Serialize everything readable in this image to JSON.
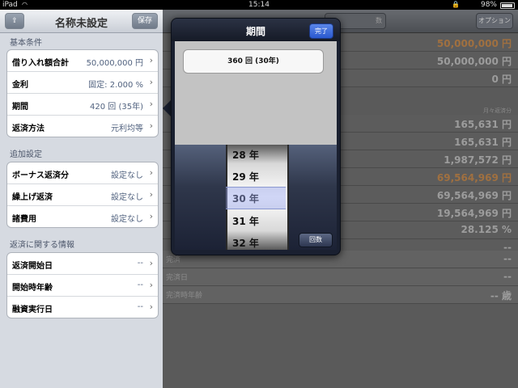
{
  "status_bar": {
    "carrier": "iPad",
    "time": "15:14",
    "battery": "98%"
  },
  "left_panel": {
    "title": "名称未設定",
    "save_label": "保存",
    "sections": [
      {
        "header": "基本条件",
        "rows": [
          {
            "label": "借り入れ額合計",
            "value": "50,000,000 円"
          },
          {
            "label": "金利",
            "value": "固定: 2.000 %"
          },
          {
            "label": "期間",
            "value": "420 回 (35年)"
          },
          {
            "label": "返済方法",
            "value": "元利均等"
          }
        ]
      },
      {
        "header": "追加設定",
        "rows": [
          {
            "label": "ボーナス返済分",
            "value": "設定なし"
          },
          {
            "label": "繰上げ返済",
            "value": "設定なし"
          },
          {
            "label": "諸費用",
            "value": "設定なし"
          }
        ]
      },
      {
        "header": "返済に関する情報",
        "rows": [
          {
            "label": "返済開始日",
            "value": "--"
          },
          {
            "label": "開始時年齢",
            "value": "--"
          },
          {
            "label": "融資実行日",
            "value": "--"
          }
        ]
      }
    ]
  },
  "right_panel": {
    "option_label": "オプション",
    "segment_label": "数",
    "caption": "月々返済分",
    "values": [
      "50,000,000 円",
      "50,000,000 円",
      "0 円",
      "165,631 円",
      "165,631 円",
      "1,987,572 円",
      "69,564,969 円",
      "69,564,969 円",
      "19,564,969 円",
      "28.125 %",
      "--"
    ],
    "bottom_labels": [
      "完済",
      "完済日",
      "完済時年齢"
    ],
    "bottom_values": [
      "--",
      "--",
      "-- 歳"
    ]
  },
  "popover": {
    "title": "期間",
    "done_label": "完了",
    "field_value": "360 回 (30年)",
    "picker_items": [
      "28 年",
      "29 年",
      "30 年",
      "31 年",
      "32 年"
    ],
    "selected": "30 年",
    "count_button": "回数"
  }
}
